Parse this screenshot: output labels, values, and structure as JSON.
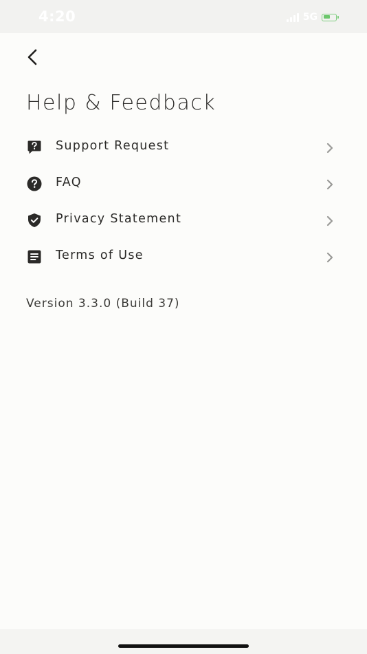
{
  "status_bar": {
    "time": "4:20",
    "network": "5G"
  },
  "header": {
    "title": "Help & Feedback"
  },
  "menu": {
    "items": [
      {
        "label": "Support Request",
        "icon": "support-request-icon"
      },
      {
        "label": "FAQ",
        "icon": "question-circle-icon"
      },
      {
        "label": "Privacy Statement",
        "icon": "shield-check-icon"
      },
      {
        "label": "Terms of Use",
        "icon": "document-icon"
      }
    ]
  },
  "footer": {
    "version": "Version 3.3.0 (Build 37)"
  },
  "colors": {
    "text": "#2b2a28",
    "chevron": "#9a9a97",
    "battery": "#6cc76c",
    "background": "#fcfcfa"
  }
}
